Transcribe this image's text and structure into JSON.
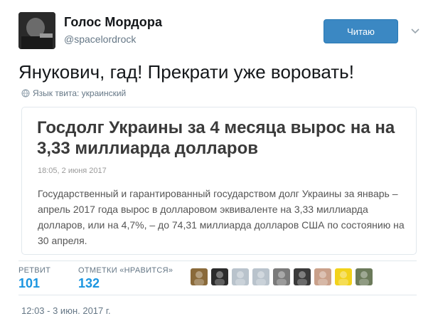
{
  "author": {
    "name": "Голос Мордора",
    "handle": "@spacelordrock"
  },
  "follow_button": {
    "label": "Читаю"
  },
  "tweet": {
    "text": "Янукович, гад! Прекрати уже воровать!",
    "language_note": "Язык твита: украинский"
  },
  "card": {
    "title": "Госдолг Украины за 4 месяца вырос на на 3,33 миллиарда долларов",
    "date": "18:05, 2 июня 2017",
    "body": "Государственный и гарантированный государством долг Украины за январь – апрель 2017 года вырос в долларовом эквиваленте на 3,33 миллиарда долларов, или на 4,7%, – до 74,31 миллиарда долларов США по состоянию на 30 апреля."
  },
  "stats": {
    "retweets_label": "РЕТВИТ",
    "retweets_value": "101",
    "likes_label": "ОТМЕТКИ «НРАВИТСЯ»",
    "likes_value": "132"
  },
  "likers": [
    {
      "name": "liker-avatar-1",
      "color": "#8a6a3a"
    },
    {
      "name": "liker-avatar-2",
      "color": "#2b2b2b"
    },
    {
      "name": "liker-avatar-3",
      "color": "#b9c3cc"
    },
    {
      "name": "liker-avatar-4",
      "color": "#b9c3cc"
    },
    {
      "name": "liker-avatar-5",
      "color": "#7a7a7a"
    },
    {
      "name": "liker-avatar-6",
      "color": "#3a3a3a"
    },
    {
      "name": "liker-avatar-7",
      "color": "#c9a08a"
    },
    {
      "name": "liker-avatar-8",
      "color": "#f2d21b"
    },
    {
      "name": "liker-avatar-9",
      "color": "#6b7a5a"
    }
  ],
  "timestamp": "12:03 - 3 июн. 2017 г.",
  "colors": {
    "accent": "#1b95e0",
    "follow_button": "#3b88c3",
    "muted": "#657786"
  }
}
